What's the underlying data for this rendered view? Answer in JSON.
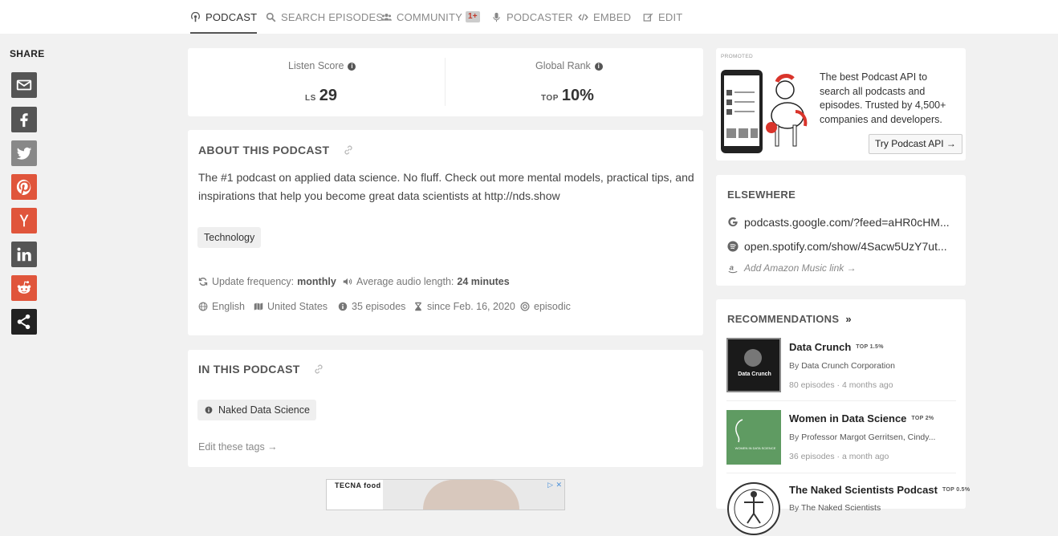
{
  "nav": {
    "tabs": [
      {
        "label": "PODCAST",
        "icon": "podcast-icon"
      },
      {
        "label": "SEARCH EPISODES",
        "icon": "search-icon"
      },
      {
        "label": "COMMUNITY",
        "icon": "users-icon",
        "badge": "1+"
      },
      {
        "label": "PODCASTER",
        "icon": "microphone-icon"
      },
      {
        "label": "EMBED",
        "icon": "code-icon"
      },
      {
        "label": "EDIT",
        "icon": "edit-icon"
      }
    ]
  },
  "share": {
    "title": "SHARE",
    "buttons": [
      {
        "name": "email",
        "color": "#555555"
      },
      {
        "name": "facebook",
        "color": "#555555"
      },
      {
        "name": "twitter",
        "color": "#888888"
      },
      {
        "name": "pinterest",
        "color": "#e0553b"
      },
      {
        "name": "hacker-news",
        "color": "#e0553b"
      },
      {
        "name": "linkedin",
        "color": "#555555"
      },
      {
        "name": "reddit",
        "color": "#e0553b"
      },
      {
        "name": "share",
        "color": "#222222"
      }
    ]
  },
  "scores": {
    "listen_label": "Listen Score",
    "listen_prefix": "LS",
    "listen_value": "29",
    "rank_label": "Global Rank",
    "rank_prefix": "TOP",
    "rank_value": "10%"
  },
  "about": {
    "title": "ABOUT THIS PODCAST",
    "description": "The #1 podcast on applied data science. No fluff. Check out more mental models, practical tips, and inspirations that help you become great data scientists at http://nds.show",
    "tag": "Technology",
    "update_label": "Update frequency:",
    "update_value": "monthly",
    "audio_label": "Average audio length:",
    "audio_value": "24 minutes",
    "language": "English",
    "country": "United States",
    "episodes": "35 episodes",
    "since": "since Feb. 16, 2020",
    "type": "episodic"
  },
  "in_podcast": {
    "title": "IN THIS PODCAST",
    "tag": "Naked Data Science",
    "edit_link": "Edit these tags →"
  },
  "promo": {
    "label": "PROMOTED",
    "text": "The best Podcast API to search all podcasts and episodes. Trusted by 4,500+ companies and developers.",
    "button": "Try Podcast API →"
  },
  "elsewhere": {
    "title": "ELSEWHERE",
    "links": [
      {
        "icon": "google-icon",
        "text": "podcasts.google.com/?feed=aHR0cHM..."
      },
      {
        "icon": "spotify-icon",
        "text": "open.spotify.com/show/4Sacw5UzY7ut..."
      }
    ],
    "amazon": "Add Amazon Music link →"
  },
  "recommendations": {
    "title": "RECOMMENDATIONS",
    "items": [
      {
        "title": "Data Crunch",
        "rank": "TOP 1.5%",
        "by": "By",
        "author": "Data Crunch Corporation",
        "meta": "80 episodes · 4 months ago",
        "img_text": "Data Crunch"
      },
      {
        "title": "Women in Data Science",
        "rank": "TOP 2%",
        "by": "By",
        "author": "Professor Margot Gerritsen, Cindy...",
        "meta": "36 episodes · a month ago",
        "img_text": "WOMEN IN DATA SCIENCE"
      },
      {
        "title": "The Naked Scientists Podcast",
        "rank": "TOP 0.5%",
        "by": "By",
        "author": "The Naked Scientists",
        "meta": "",
        "img_text": ""
      }
    ]
  },
  "ad": {
    "brand": "TECNA food"
  }
}
